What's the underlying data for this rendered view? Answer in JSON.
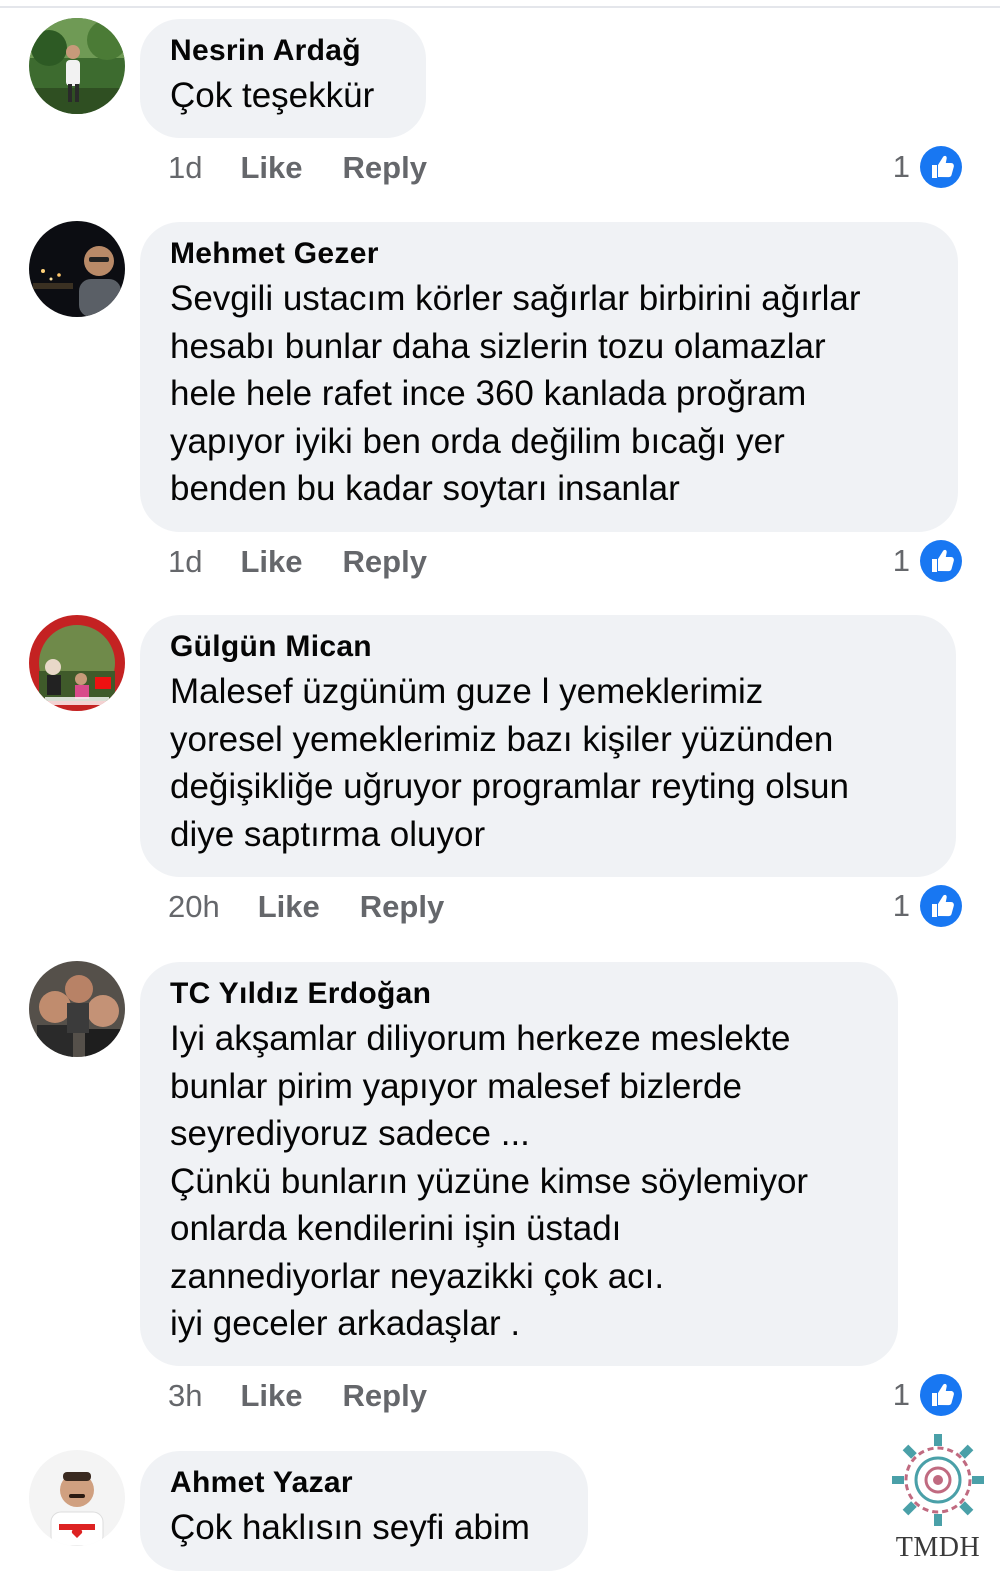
{
  "comments": [
    {
      "author": "Nesrin Ardağ",
      "text": "Çok teşekkür",
      "time": "1d",
      "like_label": "Like",
      "reply_label": "Reply",
      "reactions": "1"
    },
    {
      "author": "Mehmet Gezer",
      "text": "Sevgili ustacım körler sağırlar birbirini ağırlar\nhesabı bunlar daha sizlerin tozu olamazlar\nhele hele rafet ince 360 kanlada proğram\nyapıyor iyiki ben orda değilim bıcağı yer\nbenden bu kadar soytarı insanlar",
      "time": "1d",
      "like_label": "Like",
      "reply_label": "Reply",
      "reactions": "1"
    },
    {
      "author": "Gülgün Mican",
      "text": "Malesef üzgünüm guze l yemeklerimiz\nyoresel yemeklerimiz bazı kişiler yüzünden\ndeğişikliğe uğruyor programlar reyting olsun\ndiye saptırma oluyor",
      "time": "20h",
      "like_label": "Like",
      "reply_label": "Reply",
      "reactions": "1"
    },
    {
      "author": "TC Yıldız Erdoğan",
      "text": "Iyi akşamlar diliyorum herkeze meslekte\nbunlar  pirim yapıyor malesef  bizlerde\nseyrediyoruz sadece ...\nÇünkü bunların yüzüne kimse söylemiyor\nonlarda  kendilerini  işin üstadı\nzannediyorlar neyazikki çok acı.\niyi geceler arkadaşlar .",
      "time": "3h",
      "like_label": "Like",
      "reply_label": "Reply",
      "reactions": "1"
    },
    {
      "author": "Ahmet Yazar",
      "text": "Çok haklısın seyfi abim"
    }
  ],
  "watermark": {
    "text": "TMDH"
  },
  "icons": {
    "reaction": "like-thumb-icon"
  },
  "colors": {
    "bubble": "#f0f2f5",
    "like_blue": "#1877f2",
    "meta_text": "#65676b"
  }
}
